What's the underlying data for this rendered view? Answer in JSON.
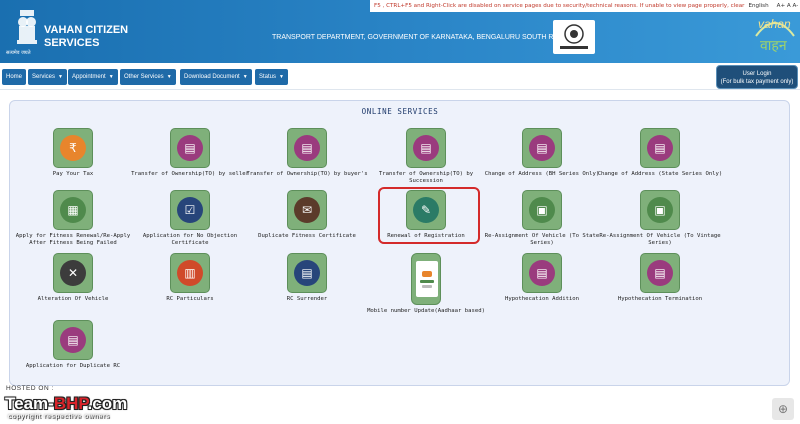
{
  "header": {
    "notice": "F5 , CTRL+F5 and Right-Click are disabled on service pages due to security/technical reasons. If unable to view page properly, clear",
    "language": "English",
    "font_controls": "A+  A  A-",
    "brand_line1": "VAHAN CITIZEN",
    "brand_line2": "SERVICES",
    "emblem_caption": "सत्यमेव जयते",
    "department": "TRANSPORT DEPARTMENT, GOVERNMENT OF KARNATAKA, BENGALURU SOUTH RTO",
    "vahan_logo_text": "vahan",
    "vahan_logo_sub": "वाहन"
  },
  "nav": {
    "items": [
      {
        "label": "Home",
        "caret": false
      },
      {
        "label": "Services",
        "caret": true
      },
      {
        "label": "Appointment",
        "caret": true
      },
      {
        "label": "Other Services",
        "caret": true
      },
      {
        "label": "Download Document",
        "caret": true
      },
      {
        "label": "Status",
        "caret": true
      }
    ],
    "login_line1": "User Login",
    "login_line2": "(For bulk tax payment only)"
  },
  "panel_title": "ONLINE SERVICES",
  "services": [
    {
      "label": "Pay Your Tax",
      "icon": "rupee-bag-icon"
    },
    {
      "label": "Transfer of Ownership(TO) by seller",
      "icon": "form-icon"
    },
    {
      "label": "Transfer of Ownership(TO) by buyer's",
      "icon": "form-icon"
    },
    {
      "label": "Transfer of Ownership(TO) by Succession",
      "icon": "form-icon"
    },
    {
      "label": "Change of Address (BH Series Only)",
      "icon": "form-icon"
    },
    {
      "label": "Change of Address (State Series Only)",
      "icon": "form-icon"
    },
    {
      "label": "Apply for Fitness Renewal/Re-Apply After Fitness Being Failed",
      "icon": "document-icon"
    },
    {
      "label": "Application for No Objection Certificate",
      "icon": "checklist-icon"
    },
    {
      "label": "Duplicate Fitness Certificate",
      "icon": "certificate-icon"
    },
    {
      "label": "Renewal of Registration",
      "icon": "edit-icon"
    },
    {
      "label": "Re-Assignment Of Vehicle (To State Series)",
      "icon": "vehicle-doc-icon"
    },
    {
      "label": "Re-Assignment Of Vehicle (To Vintage Series)",
      "icon": "vehicle-doc-icon"
    },
    {
      "label": "Alteration Of Vehicle",
      "icon": "tools-icon"
    },
    {
      "label": "RC Particulars",
      "icon": "rc-icon"
    },
    {
      "label": "RC Surrender",
      "icon": "surrender-icon"
    },
    {
      "label": "Mobile number Update(Aadhaar based)",
      "icon": "phone-icon"
    },
    {
      "label": "Hypothecation Addition",
      "icon": "form-icon"
    },
    {
      "label": "Hypothecation Termination",
      "icon": "form-icon"
    },
    {
      "label": "Application for Duplicate RC",
      "icon": "form-icon"
    }
  ],
  "watermark": {
    "hosted": "HOSTED ON :",
    "brand_a": "Team-",
    "brand_b": "BHP",
    "brand_c": ".com",
    "copyright": "copyright respective owners"
  }
}
